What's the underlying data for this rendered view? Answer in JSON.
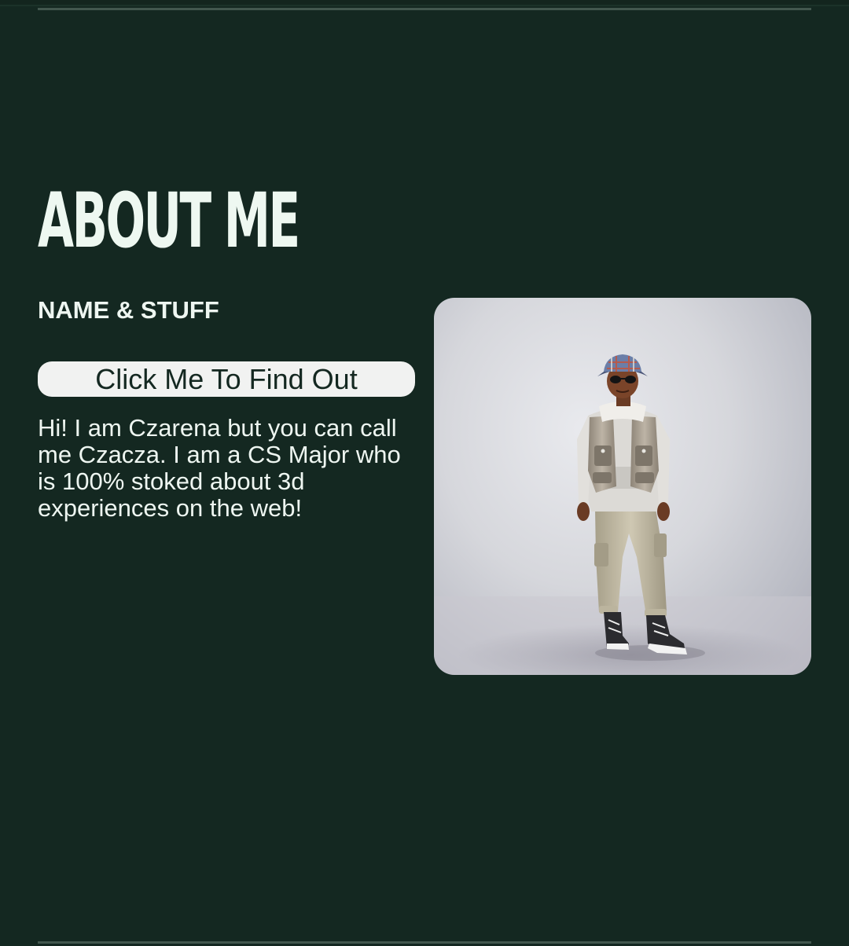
{
  "about": {
    "title": "ABOUT ME",
    "subheading": "NAME & STUFF",
    "button_label": "Click Me To Find Out",
    "bio": "Hi! I am Czarena but you can call me Czacza. I am a CS Major who is 100% stoked about 3d experiences on the web!"
  },
  "avatar": {
    "icon": "avatar-illustration"
  },
  "colors": {
    "background": "#142821",
    "text": "#eef6f1",
    "button_bg": "#f1f2f1",
    "button_text": "#142821",
    "rule": "#42574e"
  }
}
